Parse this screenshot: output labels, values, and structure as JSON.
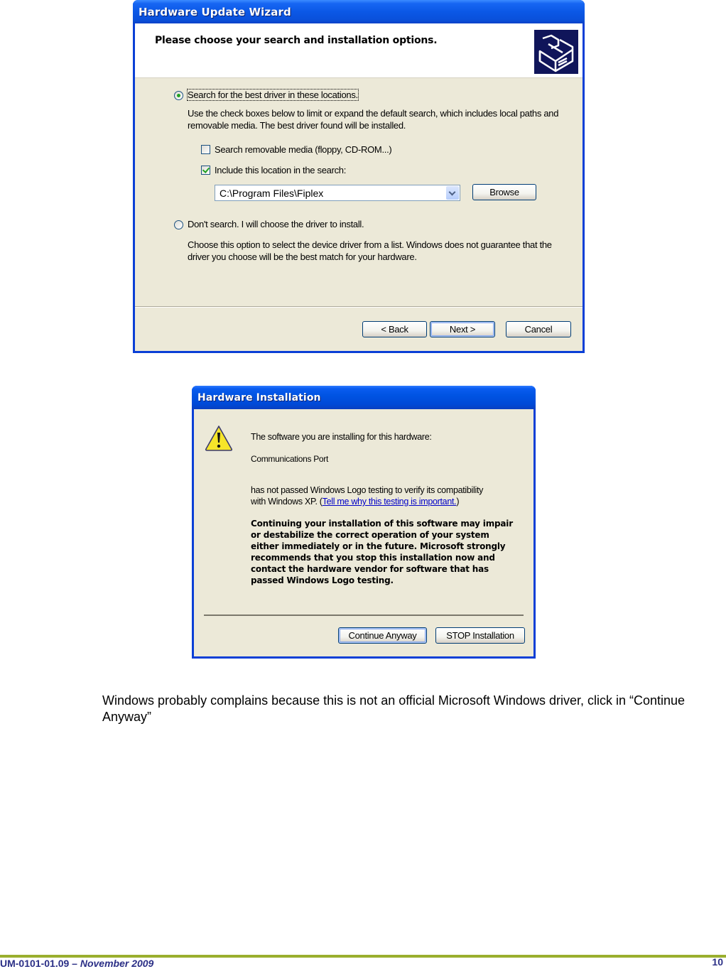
{
  "wizard": {
    "title": "Hardware Update Wizard",
    "heading": "Please choose your search and installation options.",
    "icon": "hardware-drawer-icon",
    "option_search": {
      "label": "Search for the best driver in these locations.",
      "selected": true,
      "description": "Use the check boxes below to limit or expand the default search, which includes local paths and removable media. The best driver found will be installed."
    },
    "checkbox_removable": {
      "label": "Search removable media (floppy, CD-ROM...)",
      "checked": false
    },
    "checkbox_location": {
      "label": "Include this location in the search:",
      "checked": true
    },
    "location_combo": {
      "value": "C:\\Program Files\\Fiplex"
    },
    "browse_label": "Browse",
    "option_dont_search": {
      "label": "Don't search. I will choose the driver to install.",
      "selected": false,
      "description": "Choose this option to select the device driver from a list.  Windows does not guarantee that the driver you choose will be the best match for your hardware."
    },
    "buttons": {
      "back": "< Back",
      "next": "Next >",
      "cancel": "Cancel"
    }
  },
  "hardware_installation": {
    "title": "Hardware Installation",
    "icon": "warning-icon",
    "intro": "The software you are installing for this hardware:",
    "device": "Communications Port",
    "not_passed_1": "has not passed Windows Logo testing to verify its compatibility",
    "not_passed_2": "with Windows XP. (",
    "link": "Tell me why this testing is important.",
    "not_passed_3": ")",
    "warning_lines": [
      "Continuing your installation of this software may impair",
      "or destabilize the correct operation of your system",
      "either immediately or in the future. Microsoft strongly",
      "recommends that you stop this installation now and",
      "contact the hardware vendor for software that has",
      "passed Windows Logo testing."
    ],
    "buttons": {
      "continue": "Continue Anyway",
      "stop": "STOP Installation"
    }
  },
  "document": {
    "instruction": "Windows probably complains because this is not an official Microsoft Windows driver, click in “Continue Anyway”",
    "footer_id": "UM-0101-01.09 – ",
    "footer_date": "November 2009",
    "page_number": "10",
    "footer_rule_color": "#9aaf2e",
    "footer_text_color": "#2b2f86"
  }
}
